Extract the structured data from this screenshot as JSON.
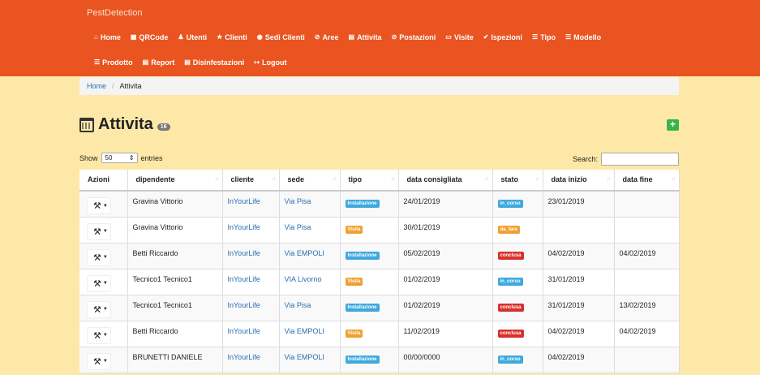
{
  "brand": "PestDetection",
  "nav_row1": [
    {
      "icon": "⌂",
      "label": "Home"
    },
    {
      "icon": "▦",
      "label": "QRCode"
    },
    {
      "icon": "♟",
      "label": "Utenti"
    },
    {
      "icon": "★",
      "label": "Clienti"
    },
    {
      "icon": "◉",
      "label": "Sedi Clienti"
    },
    {
      "icon": "⊘",
      "label": "Aree"
    },
    {
      "icon": "▤",
      "label": "Attivita"
    },
    {
      "icon": "⊘",
      "label": "Postazioni"
    },
    {
      "icon": "▭",
      "label": "Visite"
    },
    {
      "icon": "✔",
      "label": "Ispezioni"
    },
    {
      "icon": "☰",
      "label": "Tipo"
    },
    {
      "icon": "☰",
      "label": "Modello"
    }
  ],
  "nav_row2": [
    {
      "icon": "☰",
      "label": "Prodotto"
    },
    {
      "icon": "▤",
      "label": "Report"
    },
    {
      "icon": "▤",
      "label": "Disinfestazioni"
    },
    {
      "icon": "↦",
      "label": "Logout"
    }
  ],
  "breadcrumb": {
    "home": "Home",
    "separator": "/",
    "current": "Attivita"
  },
  "page": {
    "title": "Attivita",
    "count": "16",
    "add_label": "+"
  },
  "table_controls": {
    "show": "Show",
    "entries_value": "50",
    "entries": "entries",
    "search_label": "Search:",
    "search_value": ""
  },
  "columns": [
    "Azioni",
    "dipendente",
    "cliente",
    "sede",
    "tipo",
    "data consigliata",
    "stato",
    "data inizio",
    "data fine"
  ],
  "colors": {
    "navbar": "#e95420",
    "installazione": "#3fa9de",
    "visita": "#f0a030",
    "in_corso": "#3fa9de",
    "da_fare": "#f0a030",
    "conclusa": "#d9302d"
  },
  "rows": [
    {
      "dipendente": "Gravina Vittorio",
      "cliente": "InYourLife",
      "sede": "Via Pisa",
      "tipo": "Installazione",
      "tipo_color": "#3fa9de",
      "data_consigliata": "24/01/2019",
      "stato": "in_corso",
      "stato_color": "#3fa9de",
      "data_inizio": "23/01/2019",
      "data_fine": ""
    },
    {
      "dipendente": "Gravina Vittorio",
      "cliente": "InYourLife",
      "sede": "Via Pisa",
      "tipo": "Visita",
      "tipo_color": "#f0a030",
      "data_consigliata": "30/01/2019",
      "stato": "da_fare",
      "stato_color": "#f0a030",
      "data_inizio": "",
      "data_fine": ""
    },
    {
      "dipendente": "Betti Riccardo",
      "cliente": "InYourLife",
      "sede": "Via EMPOLI",
      "tipo": "Installazione",
      "tipo_color": "#3fa9de",
      "data_consigliata": "05/02/2019",
      "stato": "conclusa",
      "stato_color": "#d9302d",
      "data_inizio": "04/02/2019",
      "data_fine": "04/02/2019"
    },
    {
      "dipendente": "Tecnico1 Tecnico1",
      "cliente": "InYourLife",
      "sede": "VIA Livorno",
      "tipo": "Visita",
      "tipo_color": "#f0a030",
      "data_consigliata": "01/02/2019",
      "stato": "in_corso",
      "stato_color": "#3fa9de",
      "data_inizio": "31/01/2019",
      "data_fine": ""
    },
    {
      "dipendente": "Tecnico1 Tecnico1",
      "cliente": "InYourLife",
      "sede": "Via Pisa",
      "tipo": "Installazione",
      "tipo_color": "#3fa9de",
      "data_consigliata": "01/02/2019",
      "stato": "conclusa",
      "stato_color": "#d9302d",
      "data_inizio": "31/01/2019",
      "data_fine": "13/02/2019"
    },
    {
      "dipendente": "Betti Riccardo",
      "cliente": "InYourLife",
      "sede": "Via EMPOLI",
      "tipo": "Visita",
      "tipo_color": "#f0a030",
      "data_consigliata": "11/02/2019",
      "stato": "conclusa",
      "stato_color": "#d9302d",
      "data_inizio": "04/02/2019",
      "data_fine": "04/02/2019"
    },
    {
      "dipendente": "BRUNETTI DANIELE",
      "cliente": "InYourLife",
      "sede": "Via EMPOLI",
      "tipo": "Installazione",
      "tipo_color": "#3fa9de",
      "data_consigliata": "00/00/0000",
      "stato": "in_corso",
      "stato_color": "#3fa9de",
      "data_inizio": "04/02/2019",
      "data_fine": ""
    }
  ]
}
